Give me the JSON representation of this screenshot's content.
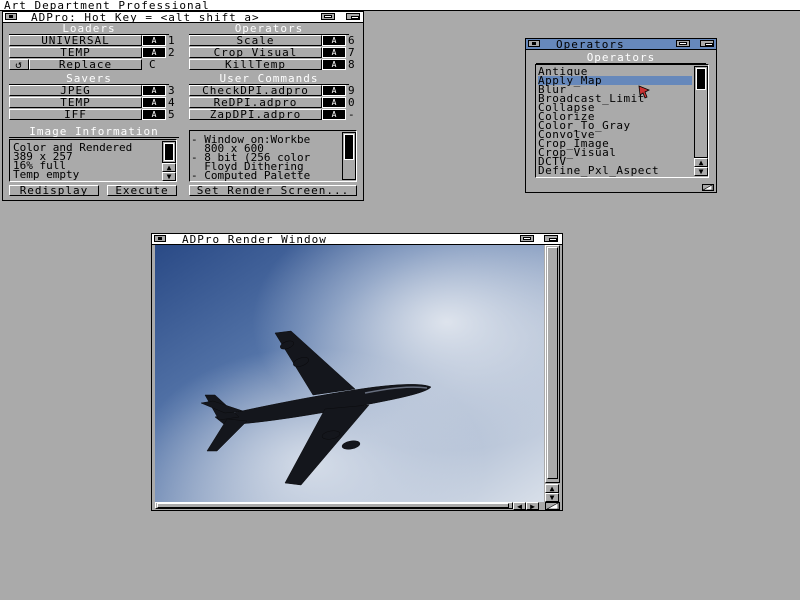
{
  "screen": {
    "title": "Art Department Professional"
  },
  "main_window": {
    "title": "ADPro: Hot Key = <alt shift a>",
    "sections": {
      "loaders": "Loaders",
      "operators": "Operators",
      "savers": "Savers",
      "user_commands": "User Commands",
      "image_information": "Image Information"
    },
    "loaders": [
      "UNIVERSAL",
      "TEMP"
    ],
    "replace_label": "Replace",
    "replace_checkbox": "C",
    "savers": [
      "JPEG",
      "TEMP",
      "IFF"
    ],
    "operators": [
      "Scale",
      "Crop_Visual",
      "KillTemp"
    ],
    "user_commands": [
      "CheckDPI.adpro",
      "ReDPI.adpro",
      "ZapDPI.adpro"
    ],
    "hotkey_label": "A",
    "hotkeys_left": [
      "1",
      "2",
      "3",
      "4",
      "5"
    ],
    "hotkeys_right": [
      "6",
      "7",
      "8",
      "9",
      "0",
      "-"
    ],
    "image_info": [
      "Color and Rendered",
      "389 x 257",
      "16% full",
      "Temp empty"
    ],
    "screen_info": [
      "- Window on:Workbe",
      "  800 x 600",
      "- 8 bit (256 color",
      "  Floyd Dithering",
      "- Computed Palette"
    ],
    "buttons": {
      "redisplay": "Redisplay",
      "execute": "Execute",
      "set_render_screen": "Set Render Screen..."
    }
  },
  "operators_window": {
    "title": "Operators",
    "heading": "Operators",
    "items": [
      "Antique",
      "Apply_Map",
      "Blur",
      "Broadcast_Limit",
      "Collapse",
      "Colorize",
      "Color_To_Gray",
      "Convolve",
      "Crop_Image",
      "Crop_Visual",
      "DCTV",
      "Define_Pxl_Aspect"
    ],
    "selected_index": 1
  },
  "render_window": {
    "title": "ADPro Render Window"
  },
  "colors": {
    "background": "#aaaaaa",
    "active_title": "#6688bb",
    "selection": "#6688bb",
    "sky_dark": "#2f4f86",
    "sky_light": "#c9d3e3"
  }
}
